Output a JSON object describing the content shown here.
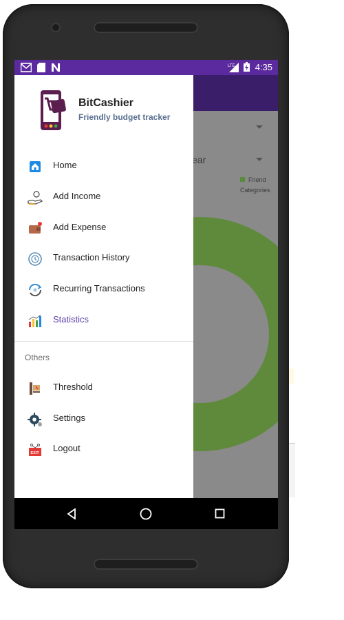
{
  "status_bar": {
    "time": "4:35",
    "icons": [
      "gmail-icon",
      "sd-card-icon",
      "n-notification-icon",
      "lte-signal-icon",
      "battery-charging-icon"
    ]
  },
  "background": {
    "dropdown_year": "ear",
    "legend": [
      "Friend",
      "Categories"
    ],
    "chart_color": "#5f8a3c"
  },
  "drawer": {
    "app_name": "BitCashier",
    "tagline": "Friendly budget tracker",
    "menu": [
      {
        "label": "Home",
        "icon": "home-icon"
      },
      {
        "label": "Add Income",
        "icon": "add-income-icon"
      },
      {
        "label": "Add Expense",
        "icon": "add-expense-icon"
      },
      {
        "label": "Transaction History",
        "icon": "transaction-history-icon"
      },
      {
        "label": "Recurring Transactions",
        "icon": "recurring-transactions-icon"
      },
      {
        "label": "Statistics",
        "icon": "statistics-icon",
        "active": true
      }
    ],
    "others_label": "Others",
    "others": [
      {
        "label": "Threshold",
        "icon": "threshold-icon"
      },
      {
        "label": "Settings",
        "icon": "settings-icon"
      },
      {
        "label": "Logout",
        "icon": "logout-icon"
      }
    ]
  },
  "nav_bar": [
    "back-icon",
    "home-nav-icon",
    "recents-icon"
  ],
  "colors": {
    "status_bar": "#5a2a9e",
    "active_item": "#5b3ea8",
    "accent": "#3b1e6a"
  }
}
